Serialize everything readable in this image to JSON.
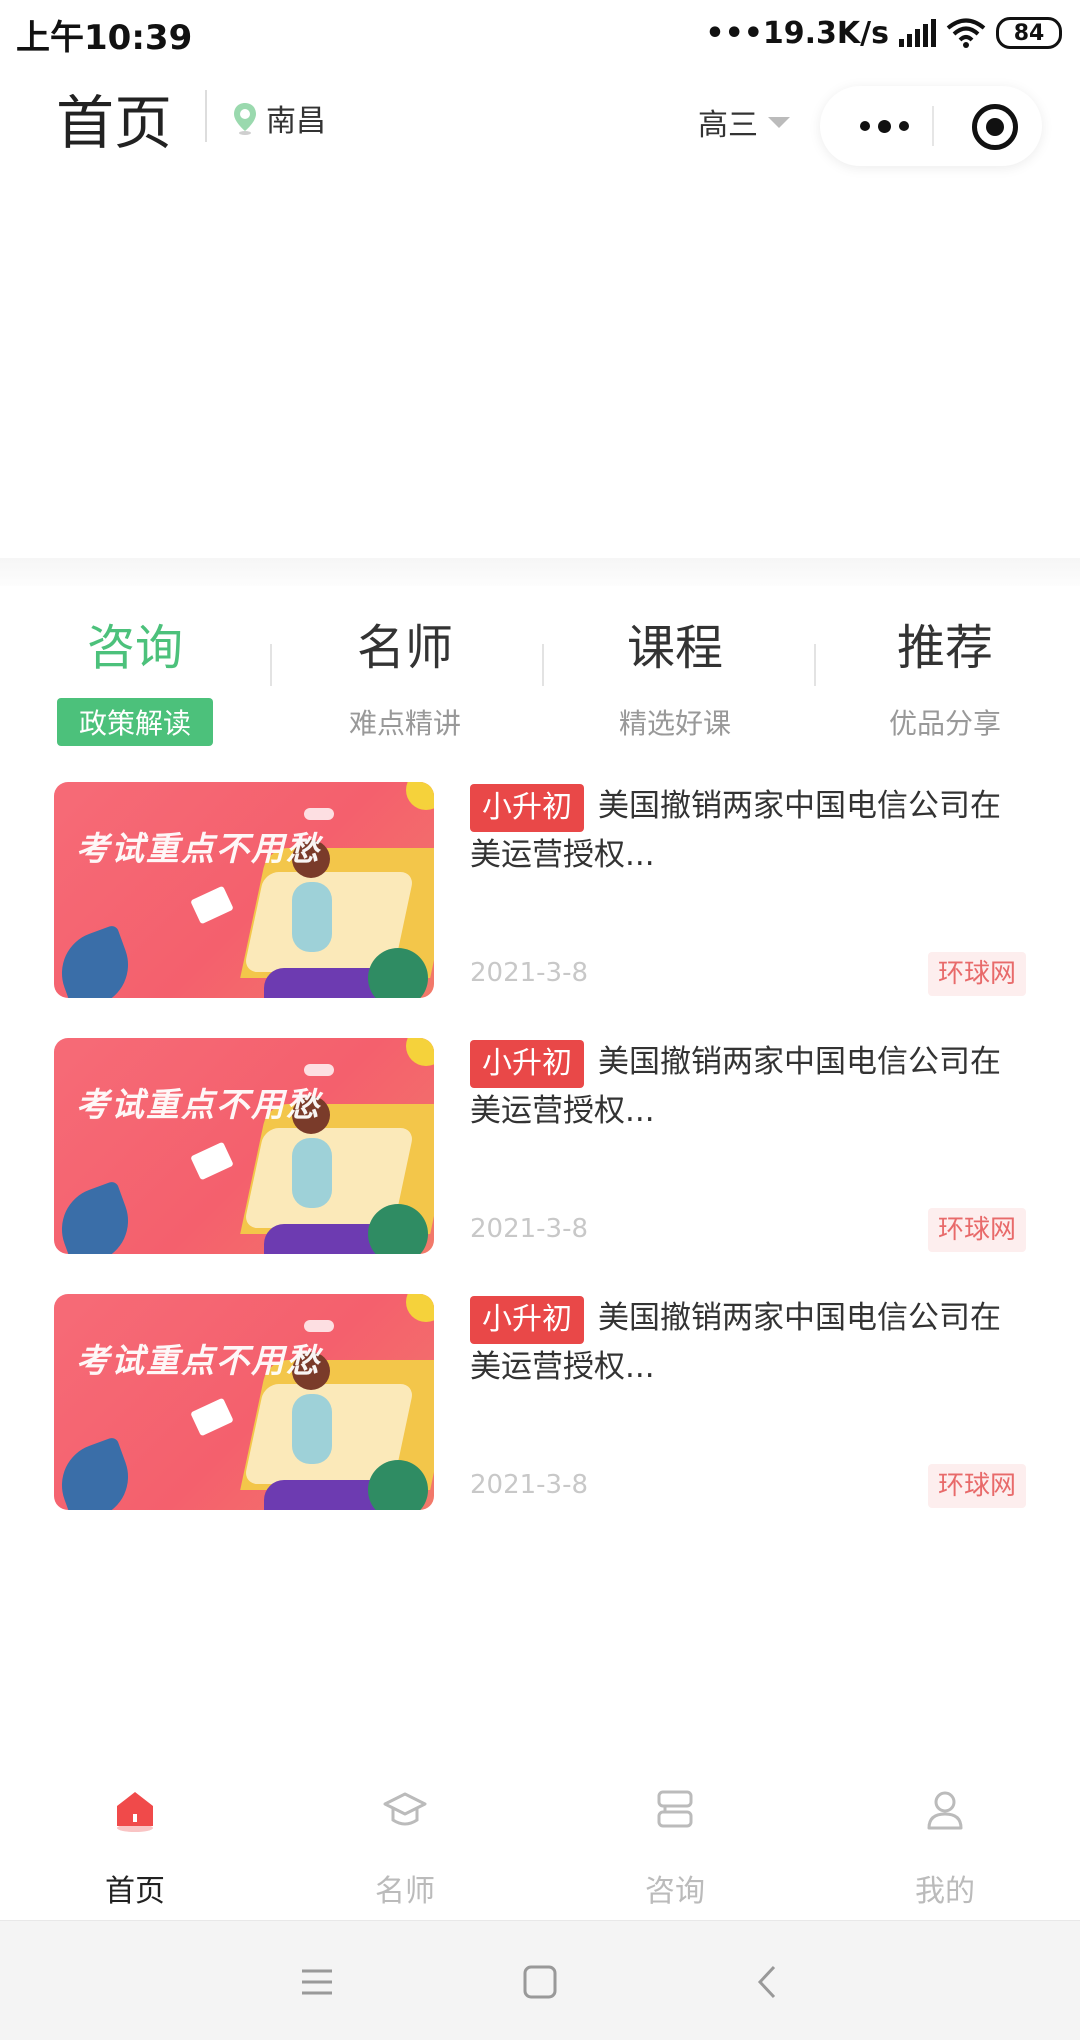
{
  "status_bar": {
    "time": "上午10:39",
    "speed": "•••19.3K/s",
    "battery": "84"
  },
  "header": {
    "title": "首页",
    "location": "南昌",
    "grade": "高三"
  },
  "categories": [
    {
      "title": "咨询",
      "subtitle": "政策解读",
      "active": true
    },
    {
      "title": "名师",
      "subtitle": "难点精讲",
      "active": false
    },
    {
      "title": "课程",
      "subtitle": "精选好课",
      "active": false
    },
    {
      "title": "推荐",
      "subtitle": "优品分享",
      "active": false
    }
  ],
  "articles": [
    {
      "thumb_text": "考试重点不用愁",
      "tag": "小升初",
      "title": "美国撤销两家中国电信公司在美运营授权...",
      "date": "2021-3-8",
      "source": "环球网"
    },
    {
      "thumb_text": "考试重点不用愁",
      "tag": "小升初",
      "title": "美国撤销两家中国电信公司在美运营授权...",
      "date": "2021-3-8",
      "source": "环球网"
    },
    {
      "thumb_text": "考试重点不用愁",
      "tag": "小升初",
      "title": "美国撤销两家中国电信公司在美运营授权...",
      "date": "2021-3-8",
      "source": "环球网"
    }
  ],
  "tabbar": [
    {
      "label": "首页",
      "icon": "home-icon",
      "active": true
    },
    {
      "label": "名师",
      "icon": "graduation-cap-icon",
      "active": false
    },
    {
      "label": "咨询",
      "icon": "scroll-icon",
      "active": false
    },
    {
      "label": "我的",
      "icon": "user-icon",
      "active": false
    }
  ],
  "colors": {
    "accent_green": "#4cc17b",
    "tag_red": "#e94848",
    "source_red": "#e86a6a",
    "active_home_red": "#f04a4a"
  }
}
